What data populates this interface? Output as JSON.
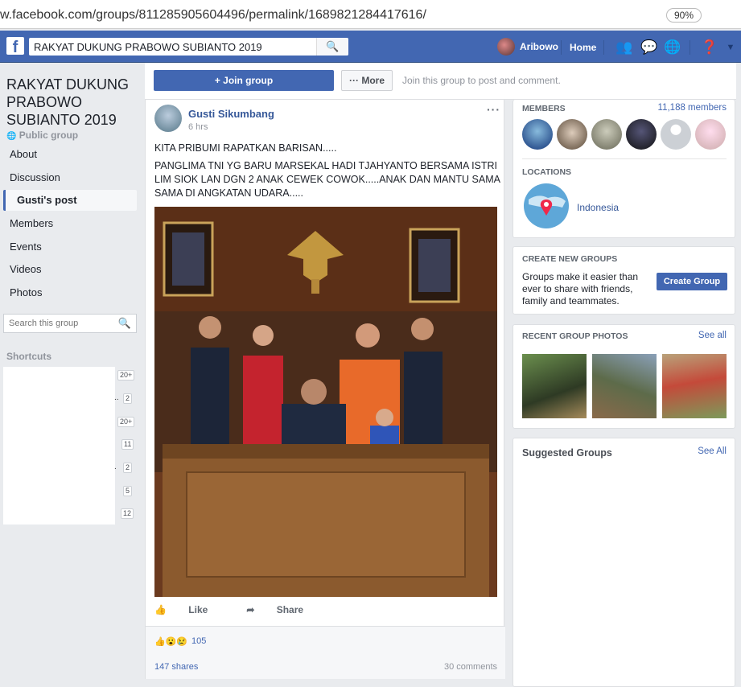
{
  "browser": {
    "url": "w.facebook.com/groups/811285905604496/permalink/1689821284417616/",
    "zoom": "90%"
  },
  "topbar": {
    "logo": "f",
    "search_value": "RAKYAT DUKUNG PRABOWO SUBIANTO 2019",
    "user_name": "Aribowo",
    "home_label": "Home"
  },
  "group": {
    "title": "RAKYAT DUKUNG PRABOWO SUBIANTO 2019",
    "type": "Public group"
  },
  "nav": [
    "About",
    "Discussion",
    "Gusti's post",
    "Members",
    "Events",
    "Videos",
    "Photos"
  ],
  "left_search": {
    "placeholder": "Search this group"
  },
  "shortcuts": {
    "heading": "Shortcuts",
    "counts": [
      "20+",
      "2",
      "20+",
      "11",
      "2",
      "5",
      "12"
    ]
  },
  "actions": {
    "join_label": "+ Join group",
    "more_label": "··· More",
    "join_text": "Join this group to post and comment."
  },
  "post": {
    "author": "Gusti Sikumbang",
    "time": "6 hrs",
    "line1": "KITA PRIBUMI RAPATKAN BARISAN.....",
    "line2": "PANGLIMA TNI YG BARU MARSEKAL HADI TJAHYANTO BERSAMA ISTRI LIM SIOK LAN DGN 2 ANAK CEWEK COWOK.....ANAK DAN MANTU SAMA SAMA DI ANGKATAN UDARA.....",
    "like_label": "Like",
    "share_label": "Share",
    "reaction_count": "105",
    "shares": "147 shares",
    "comments": "30 comments"
  },
  "members": {
    "heading": "MEMBERS",
    "count": "11,188 members"
  },
  "locations": {
    "heading": "LOCATIONS",
    "place": "Indonesia"
  },
  "create_groups": {
    "heading": "CREATE NEW GROUPS",
    "text": "Groups make it easier than ever to share with friends, family and teammates.",
    "button": "Create Group"
  },
  "recent_photos": {
    "heading": "RECENT GROUP PHOTOS",
    "link": "See all"
  },
  "suggested": {
    "heading": "Suggested Groups",
    "link": "See All"
  },
  "colors": {
    "brand": "#4267b2",
    "link": "#365899",
    "background": "#e9ebee"
  }
}
